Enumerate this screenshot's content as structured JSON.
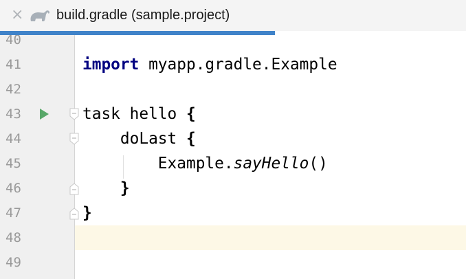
{
  "tab": {
    "title": "build.gradle (sample.project)",
    "close_icon": "close-icon",
    "file_icon": "gradle-elephant-icon"
  },
  "editor": {
    "lines": [
      {
        "num": "40"
      },
      {
        "num": "41",
        "kw": "import",
        "rest": " myapp.gradle.Example"
      },
      {
        "num": "42"
      },
      {
        "num": "43",
        "t1": "task hello ",
        "brace": "{"
      },
      {
        "num": "44",
        "t1": "    doLast ",
        "brace": "{"
      },
      {
        "num": "45",
        "t1": "        Example.",
        "italic": "sayHello",
        "t2": "()"
      },
      {
        "num": "46",
        "t1": "    ",
        "brace": "}"
      },
      {
        "num": "47",
        "brace": "}"
      },
      {
        "num": "48"
      },
      {
        "num": "49"
      }
    ],
    "current_line": "48",
    "colors": {
      "accent": "#4083c9",
      "run": "#59a869",
      "current_line": "#fdf8e6"
    }
  }
}
